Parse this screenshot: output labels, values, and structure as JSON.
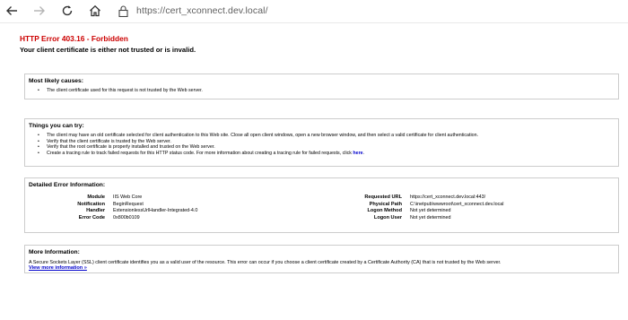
{
  "browser": {
    "url": "https://cert_xconnect.dev.local/",
    "icons": [
      "back-icon",
      "forward-icon",
      "reload-icon",
      "home-icon",
      "lock-icon"
    ]
  },
  "error": {
    "title": "HTTP Error 403.16 - Forbidden",
    "subtitle": "Your client certificate is either not trusted or is invalid."
  },
  "causes": {
    "title": "Most likely causes:",
    "items": [
      "The client certificate used for this request is not trusted by the Web server."
    ]
  },
  "try": {
    "title": "Things you can try:",
    "items": [
      "The client may have an old certificate selected for client authentication to this Web site. Close all open client windows, open a new browser window, and then select a valid certificate for client authentication.",
      "Verify that the client certificate is trusted by the Web server.",
      "Verify that the root certificate is properly installed and trusted on the Web server."
    ],
    "last_item_text": "Create a tracing rule to track failed requests for this HTTP status code. For more information about creating a tracing rule for failed requests, click ",
    "last_item_link": "here",
    "last_item_end": "."
  },
  "details": {
    "title": "Detailed Error Information:",
    "left": [
      {
        "label": "Module",
        "value": "IIS Web Core"
      },
      {
        "label": "Notification",
        "value": "BeginRequest"
      },
      {
        "label": "Handler",
        "value": "ExtensionlessUrlHandler-Integrated-4.0"
      },
      {
        "label": "Error Code",
        "value": "0x800b0109"
      }
    ],
    "right": [
      {
        "label": "Requested URL",
        "value": "https://cert_xconnect.dev.local:443/"
      },
      {
        "label": "Physical Path",
        "value": "C:\\inetpub\\wwwroot\\cert_xconnect.dev.local"
      },
      {
        "label": "Logon Method",
        "value": "Not yet determined"
      },
      {
        "label": "Logon User",
        "value": "Not yet determined"
      }
    ]
  },
  "more": {
    "title": "More Information:",
    "text": "A Secure Sockets Layer (SSL) client certificate identifies you as a valid user of the resource. This error can occur if you choose a client certificate created by a Certificate Authority (CA) that is not trusted by the Web server.",
    "link": "View more information »"
  }
}
